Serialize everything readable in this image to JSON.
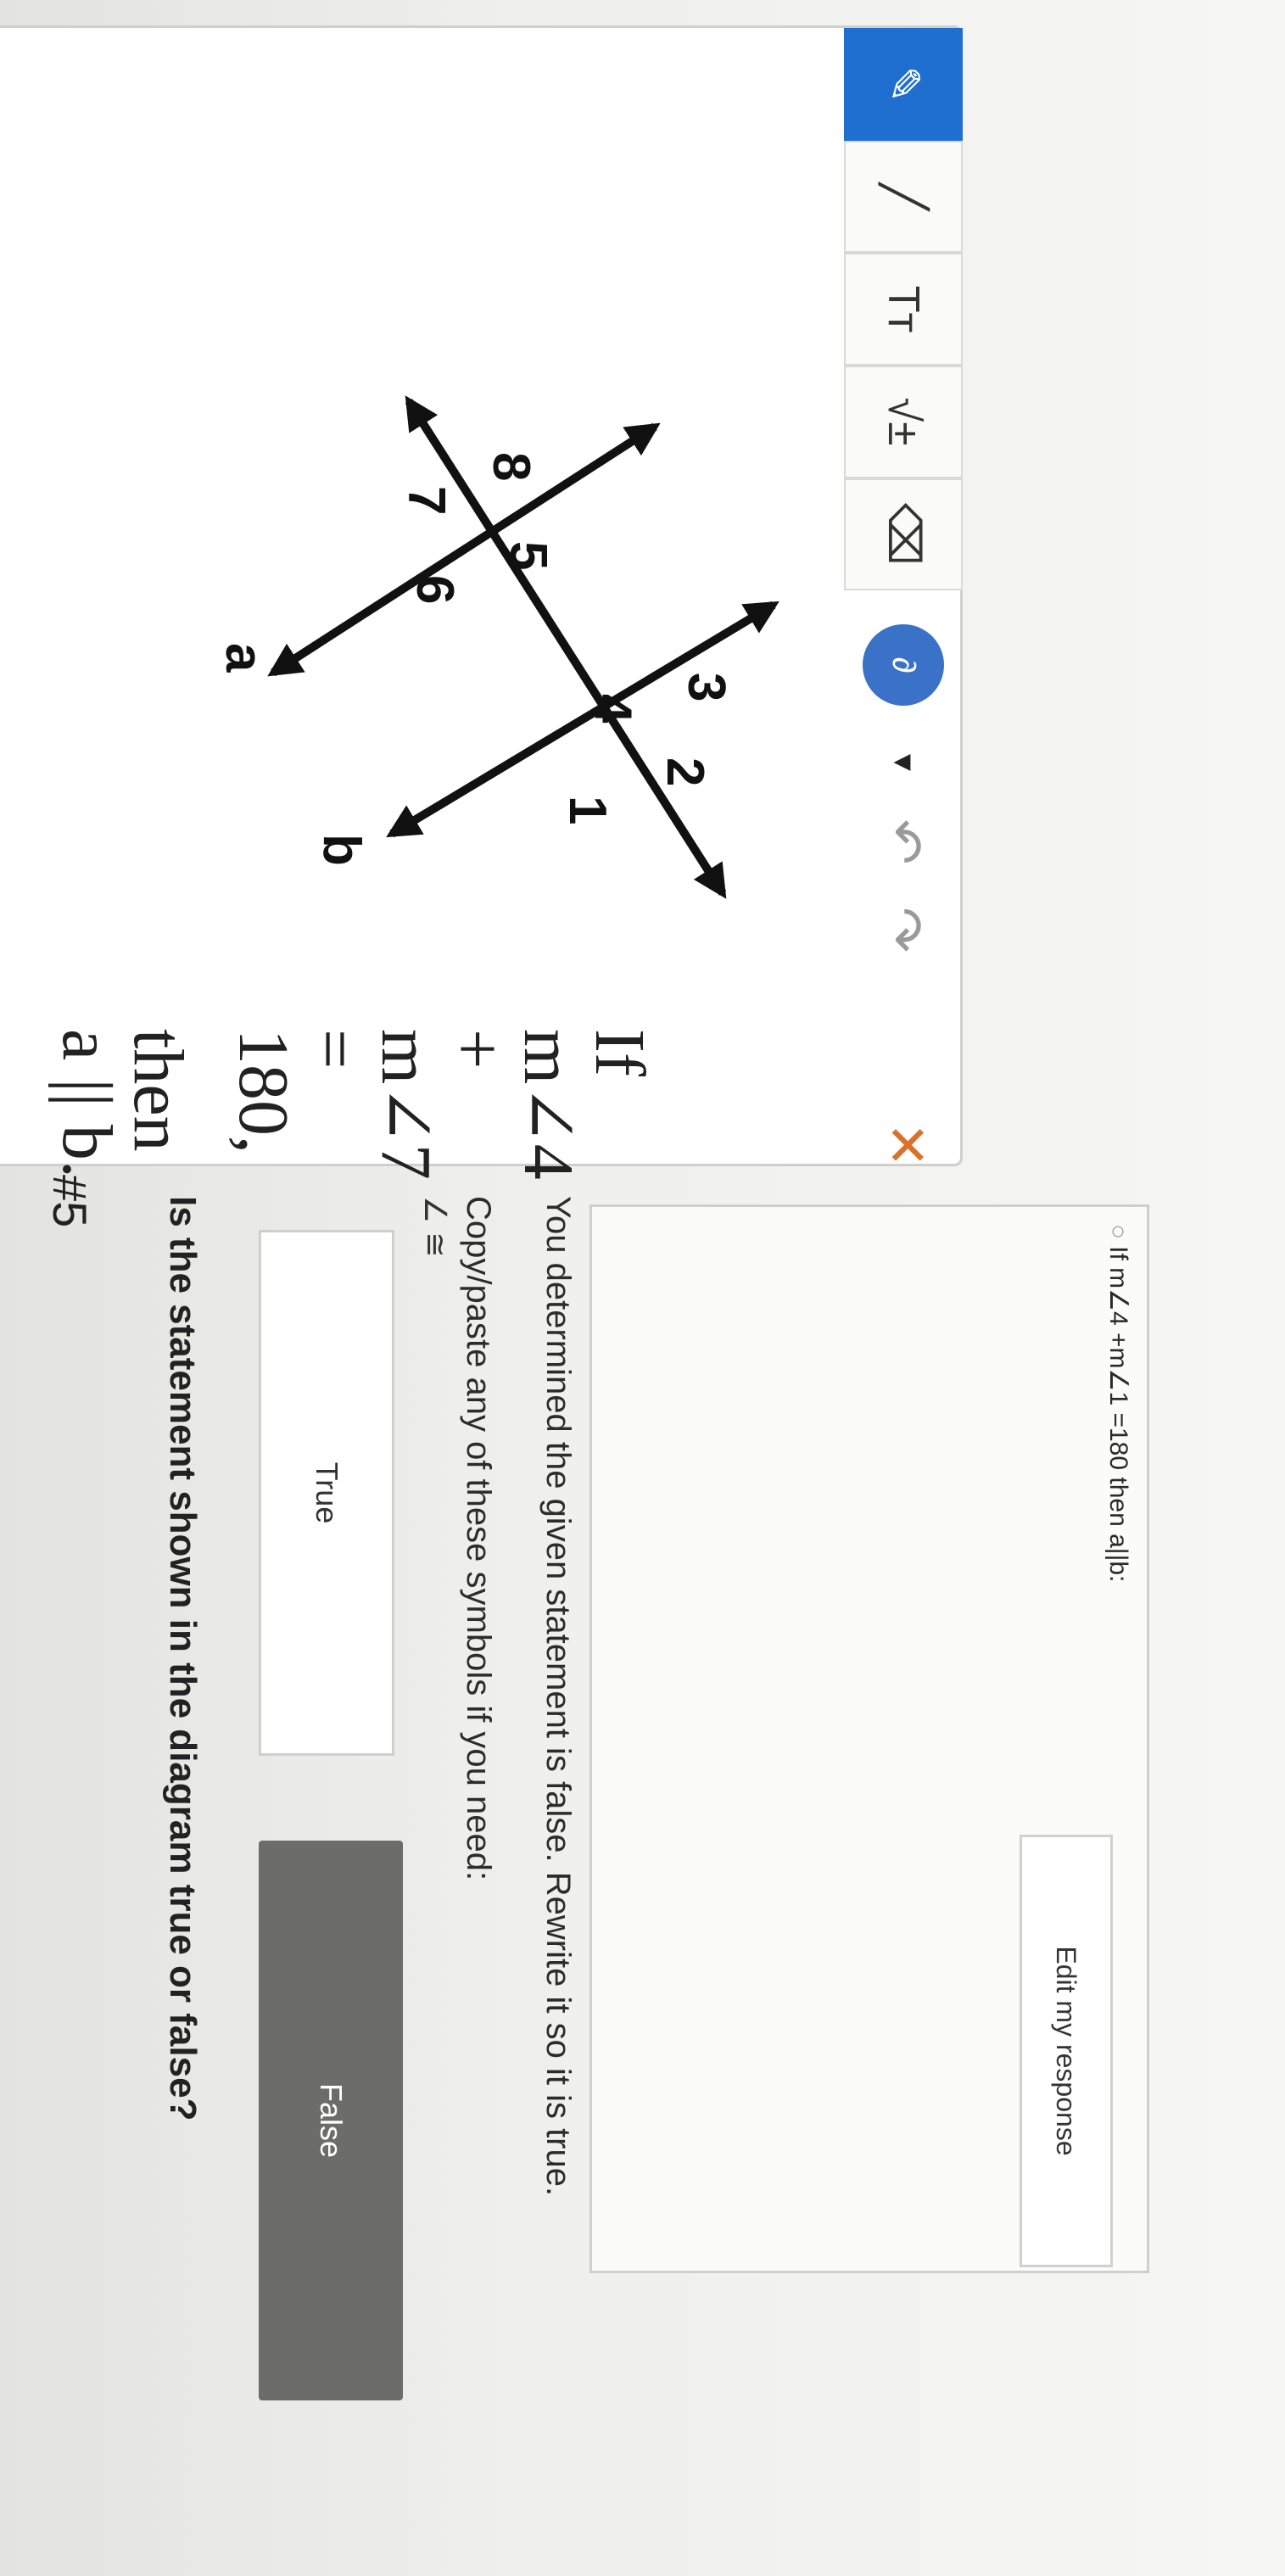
{
  "toolbar": {
    "tools": [
      {
        "name": "pen",
        "icon": "pencil-icon",
        "glyph": "✎"
      },
      {
        "name": "line",
        "icon": "line-icon",
        "glyph": "╱"
      },
      {
        "name": "text",
        "icon": "text-size-icon",
        "glyph": "Tт"
      },
      {
        "name": "math",
        "icon": "sqrt-icon",
        "glyph": "√±"
      },
      {
        "name": "eraser",
        "icon": "eraser-icon",
        "glyph": "⌫"
      }
    ],
    "color_dot_glyph": "∂",
    "color_accent": "#1f6fd0",
    "close_glyph": "✕"
  },
  "diagram": {
    "angle_labels": [
      "2",
      "1",
      "3",
      "4",
      "5",
      "6",
      "8",
      "7"
    ],
    "line_labels": {
      "a": "a",
      "b": "b"
    }
  },
  "statement": {
    "line1": "If m∠4 + m∠7 = 180,",
    "line2": "then a || b."
  },
  "question": {
    "number": "#5",
    "prompt": "Is the statement shown in the diagram true or false?",
    "choices": {
      "true": "True",
      "false": "False"
    },
    "instruction": "You determined the given statement is false. Rewrite it so it is true.",
    "symbols_label": "Copy/paste any of these symbols if you need:",
    "symbols": "∠ ≅",
    "response": "If m∠4 +m∠1 =180 then a||b:",
    "edit_button": "Edit my response"
  }
}
